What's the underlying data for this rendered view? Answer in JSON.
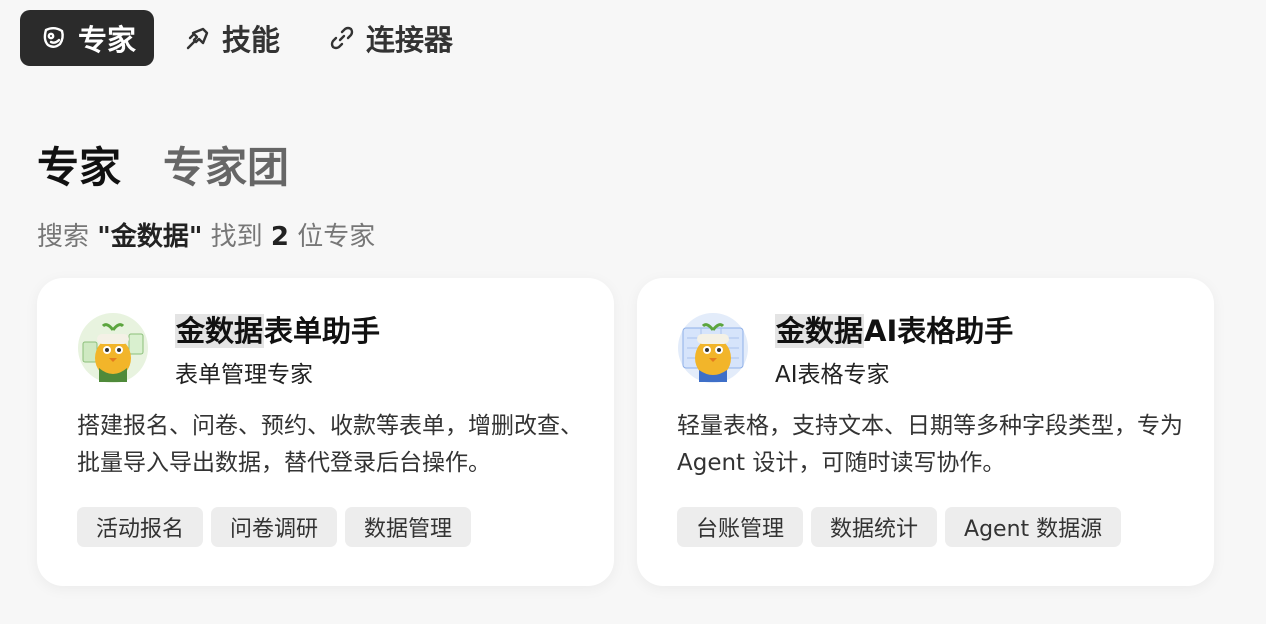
{
  "nav": {
    "tabs": [
      {
        "label": "专家",
        "icon": "expert-icon",
        "active": true
      },
      {
        "label": "技能",
        "icon": "skill-icon",
        "active": false
      },
      {
        "label": "连接器",
        "icon": "link-icon",
        "active": false
      }
    ]
  },
  "subtabs": {
    "expert": "专家",
    "team": "专家团"
  },
  "search": {
    "prefix": "搜索",
    "query": "\"金数据\"",
    "mid": "找到",
    "count": "2",
    "suffix": "位专家"
  },
  "cards": [
    {
      "title_highlight": "金数据",
      "title_rest": "表单助手",
      "subtitle": "表单管理专家",
      "description": "搭建报名、问卷、预约、收款等表单，增删改查、批量导入导出数据，替代登录后台操作。",
      "tags": [
        "活动报名",
        "问卷调研",
        "数据管理"
      ]
    },
    {
      "title_highlight": "金数据",
      "title_rest": "AI表格助手",
      "subtitle": "AI表格专家",
      "description": "轻量表格，支持文本、日期等多种字段类型，专为 Agent 设计，可随时读写协作。",
      "tags": [
        "台账管理",
        "数据统计",
        "Agent 数据源"
      ]
    }
  ],
  "colors": {
    "accent_dark": "#2b2b2b",
    "tag_bg": "#ededed",
    "highlight": "#e4e4e4"
  }
}
